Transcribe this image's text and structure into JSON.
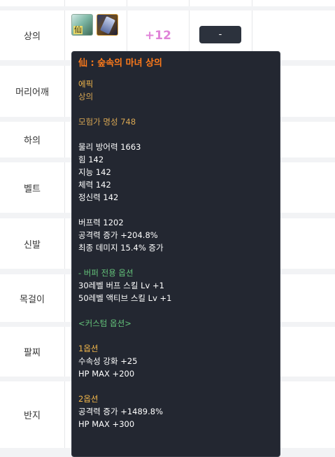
{
  "equipment_rows": [
    {
      "slot": "상의",
      "reinforce": "+12",
      "button": "-"
    },
    {
      "slot": "머리어깨"
    },
    {
      "slot": "하의"
    },
    {
      "slot": "벨트"
    },
    {
      "slot": "신발"
    },
    {
      "slot": "목걸이"
    },
    {
      "slot": "팔찌"
    },
    {
      "slot": "반지"
    }
  ],
  "item_icon_glyph": "仙",
  "tooltip": {
    "title": "仙 : 숲속의 마녀 상의",
    "rarity": "에픽",
    "type": "상의",
    "fame": "모험가 명성 748",
    "stats": [
      "물리 방어력 1663",
      "힘 142",
      "지능 142",
      "체력 142",
      "정신력 142"
    ],
    "buff_stats": [
      "버프력 1202",
      "공격력 증가 +204.8%",
      "최종 데미지 15.4% 증가"
    ],
    "buffer_header": "- 버퍼 전용 옵션",
    "buffer_options": [
      "30레벨 버프 스킬 Lv +1",
      "50레벨 액티브 스킬 Lv +1"
    ],
    "custom_header": "<커스텀 옵션>",
    "option1_header": "1옵션",
    "option1_lines": [
      "수속성 강화 +25",
      "HP MAX +200"
    ],
    "option2_header": "2옵션",
    "option2_lines": [
      "공격력 증가 +1489.8%",
      "HP MAX +300"
    ]
  },
  "colors": {
    "title": "#ff7a1a",
    "rarity": "#f1b64a",
    "fame": "#d7a653",
    "green": "#64c37a",
    "reinforce": "#e083d8"
  }
}
